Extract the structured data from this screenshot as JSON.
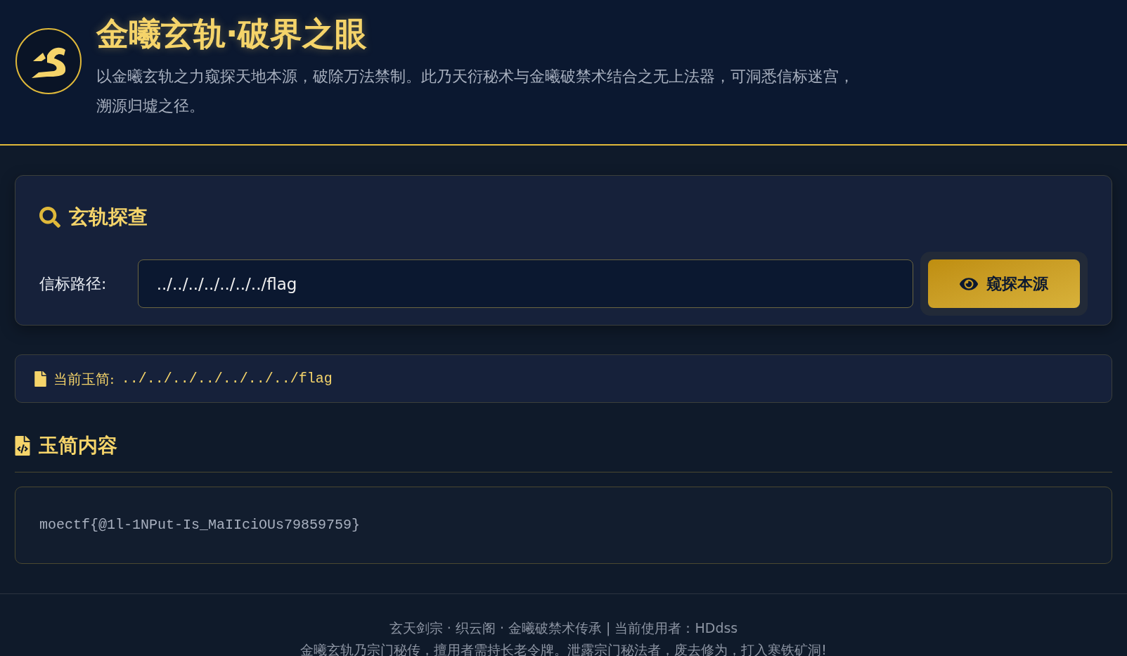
{
  "header": {
    "title": "金曦玄轨·破界之眼",
    "description": "以金曦玄轨之力窥探天地本源，破除万法禁制。此乃天衍秘术与金曦破禁术结合之无上法器，可洞悉信标迷宫，溯源归墟之径。"
  },
  "search_panel": {
    "title": "玄轨探查",
    "field_label": "信标路径:",
    "field_value": "../../../../../../../flag",
    "button": "窥探本源"
  },
  "current_file": {
    "label": "当前玉简:",
    "path": "../../../../../../../flag"
  },
  "content_section": {
    "title": "玉简内容",
    "content": "moectf{@1l-1NPut-Is_MaIIciOUs79859759}"
  },
  "footer": {
    "lines": [
      "玄天剑宗 · 织云阁 · 金曦破禁术传承 | 当前使用者：HDdss",
      "金曦玄轨乃宗门秘传，擅用者需持长老令牌。泄露宗门秘法者，废去修为，打入寒铁矿洞!"
    ]
  }
}
